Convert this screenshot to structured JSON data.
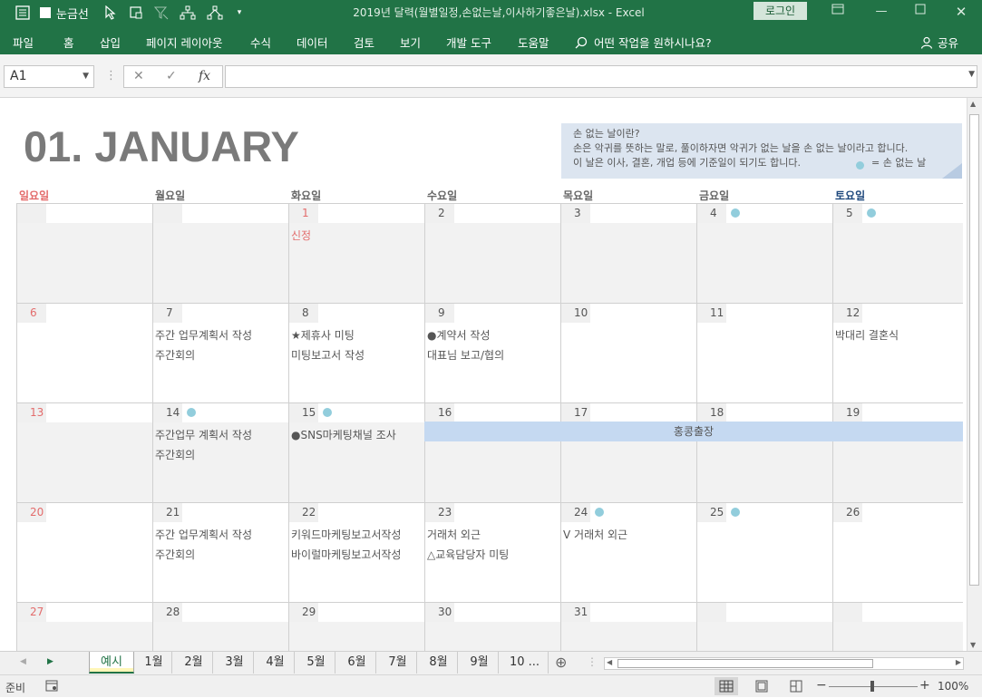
{
  "window": {
    "title": "2019년 달력(월별일정,손없는날,이사하기좋은날).xlsx  -  Excel",
    "login_label": "로그인",
    "gridlines_label": "눈금선"
  },
  "ribbon": {
    "menus": [
      "파일",
      "홈",
      "삽입",
      "페이지 레이아웃",
      "수식",
      "데이터",
      "검토",
      "보기",
      "개발 도구",
      "도움말"
    ],
    "tell_me": "어떤 작업을 원하시나요?",
    "share": "공유"
  },
  "formula_bar": {
    "name_box": "A1",
    "fx": "fx",
    "formula": ""
  },
  "calendar": {
    "month_title": "01. JANUARY",
    "info": {
      "line1": "손 없는 날이란?",
      "line2": "손은 악귀를 뜻하는 말로, 풀이하자면 악귀가 없는 날을 손 없는 날이라고 합니다.",
      "line3": "이 날은 이사, 결혼, 개업 등에 기준일이 되기도 합니다.",
      "legend": "= 손 없는 날"
    },
    "days": [
      "일요일",
      "월요일",
      "화요일",
      "수요일",
      "목요일",
      "금요일",
      "토요일"
    ],
    "weeks": [
      [
        {
          "num": "",
          "events": [],
          "dot": false
        },
        {
          "num": "",
          "events": [],
          "dot": false
        },
        {
          "num": "1",
          "events": [
            "신정"
          ],
          "dot": false,
          "holiday": true
        },
        {
          "num": "2",
          "events": [],
          "dot": false
        },
        {
          "num": "3",
          "events": [],
          "dot": false
        },
        {
          "num": "4",
          "events": [],
          "dot": true
        },
        {
          "num": "5",
          "events": [],
          "dot": true
        }
      ],
      [
        {
          "num": "6",
          "events": [],
          "dot": false
        },
        {
          "num": "7",
          "events": [
            "주간 업무계획서 작성",
            "주간회의"
          ],
          "dot": false
        },
        {
          "num": "8",
          "events": [
            "★제휴사 미팅",
            "미팅보고서 작성"
          ],
          "dot": false
        },
        {
          "num": "9",
          "events": [
            "●계약서 작성",
            "대표님 보고/협의"
          ],
          "dot": false
        },
        {
          "num": "10",
          "events": [],
          "dot": false
        },
        {
          "num": "11",
          "events": [],
          "dot": false
        },
        {
          "num": "12",
          "events": [
            "박대리 결혼식"
          ],
          "dot": false
        }
      ],
      [
        {
          "num": "13",
          "events": [],
          "dot": false
        },
        {
          "num": "14",
          "events": [
            "주간업무 계획서 작성",
            "주간회의"
          ],
          "dot": true
        },
        {
          "num": "15",
          "events": [
            "●SNS마케팅채널 조사"
          ],
          "dot": true
        },
        {
          "num": "16",
          "events": [],
          "dot": false
        },
        {
          "num": "17",
          "events": [],
          "dot": false
        },
        {
          "num": "18",
          "events": [],
          "dot": false
        },
        {
          "num": "19",
          "events": [],
          "dot": false
        }
      ],
      [
        {
          "num": "20",
          "events": [],
          "dot": false
        },
        {
          "num": "21",
          "events": [
            "주간 업무계획서 작성",
            "주간회의"
          ],
          "dot": false
        },
        {
          "num": "22",
          "events": [
            "키워드마케팅보고서작성",
            "바이럴마케팅보고서작성"
          ],
          "dot": false
        },
        {
          "num": "23",
          "events": [
            "거래처 외근",
            "△교육담당자 미팅"
          ],
          "dot": false
        },
        {
          "num": "24",
          "events": [
            "V 거래처 외근"
          ],
          "dot": true
        },
        {
          "num": "25",
          "events": [],
          "dot": true
        },
        {
          "num": "26",
          "events": [],
          "dot": false
        }
      ],
      [
        {
          "num": "27",
          "events": [],
          "dot": false
        },
        {
          "num": "28",
          "events": [],
          "dot": false
        },
        {
          "num": "29",
          "events": [],
          "dot": false
        },
        {
          "num": "30",
          "events": [],
          "dot": false
        },
        {
          "num": "31",
          "events": [],
          "dot": false
        },
        {
          "num": "",
          "events": [],
          "dot": false
        },
        {
          "num": "",
          "events": [],
          "dot": false
        }
      ]
    ],
    "band_label": "홍콩출장"
  },
  "sheet_tabs": [
    "예시",
    "1월",
    "2월",
    "3월",
    "4월",
    "5월",
    "6월",
    "7월",
    "8월",
    "9월",
    "10 ..."
  ],
  "status": {
    "ready": "준비",
    "zoom": "100%"
  },
  "colors": {
    "excel_green": "#217346",
    "holiday_red": "#e36c6c",
    "saturday_blue": "#1f497d",
    "dot": "#92cddc",
    "band": "#c5d9f1"
  }
}
